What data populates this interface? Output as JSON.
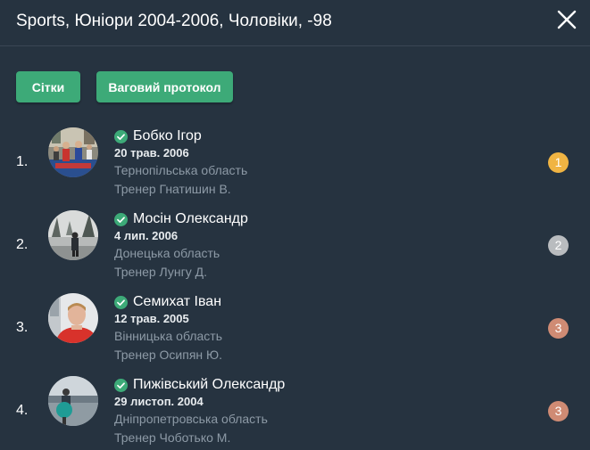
{
  "header": {
    "title": "Sports, Юніори 2004-2006, Чоловіки, -98",
    "close_icon": "close-icon"
  },
  "actions": {
    "grids_label": "Сітки",
    "protocol_label": "Ваговий протокол"
  },
  "athletes": [
    {
      "rank": "1.",
      "name": "Бобко Ігор",
      "dob": "20 трав. 2006",
      "region": "Тернопільська область",
      "coach": "Тренер Гнатишин В.",
      "place": "1",
      "medal_color": "#f0b443",
      "verified": true
    },
    {
      "rank": "2.",
      "name": "Мосін Олександр",
      "dob": "4 лип. 2006",
      "region": "Донецька область",
      "coach": "Тренер Лунгу Д.",
      "place": "2",
      "medal_color": "#b9bcbf",
      "verified": true
    },
    {
      "rank": "3.",
      "name": "Семихат Іван",
      "dob": "12 трав. 2005",
      "region": "Вінницька область",
      "coach": "Тренер Осипян Ю.",
      "place": "3",
      "medal_color": "#cf8b74",
      "verified": true
    },
    {
      "rank": "4.",
      "name": "Пижівський Олександр",
      "dob": "29 листоп. 2004",
      "region": "Дніпропетровська область",
      "coach": "Тренер Чоботько М.",
      "place": "3",
      "medal_color": "#cf8b74",
      "verified": true
    }
  ],
  "colors": {
    "background": "#263340",
    "accent": "#3daa78",
    "muted_text": "#8d9aa6"
  }
}
